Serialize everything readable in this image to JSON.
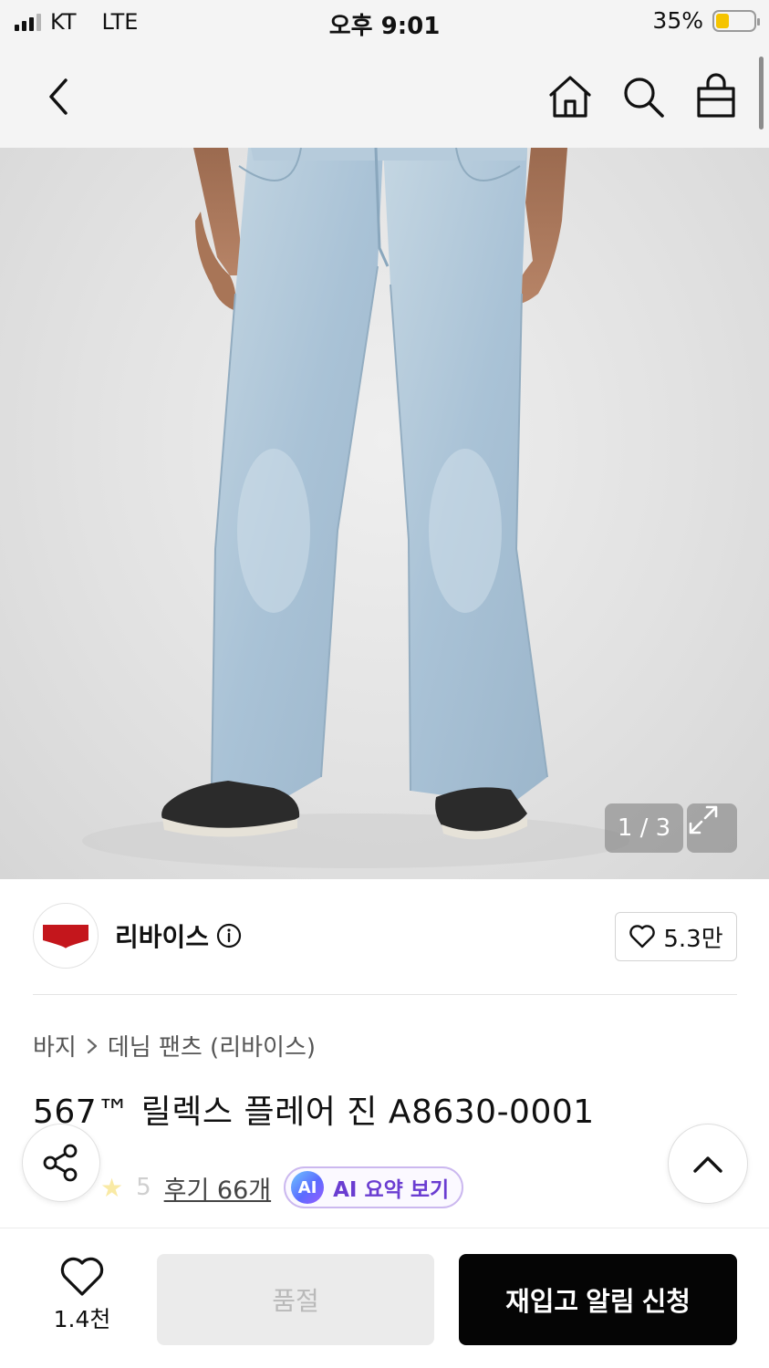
{
  "status_bar": {
    "carrier": "KT",
    "network": "LTE",
    "time": "오후 9:01",
    "battery": "35%",
    "battery_level": 0.35
  },
  "nav": {
    "icons": [
      "back-icon",
      "home-icon",
      "search-icon",
      "shopping-bag-icon"
    ]
  },
  "gallery": {
    "counter": "1 / 3",
    "expand_icon": "expand-icon"
  },
  "brand": {
    "logo_text": "Levi's",
    "name": "리바이스",
    "likes": "5.3만"
  },
  "product": {
    "breadcrumb": [
      "바지",
      "데님 팬츠 (리바이스)"
    ],
    "title": "567™ 릴렉스 플레어 진 A8630-0001",
    "rating": "5",
    "reviews": "후기 66개",
    "ai_badge": "AI",
    "ai_summary": "AI 요약 보기"
  },
  "bottom_bar": {
    "wish_count": "1.4천",
    "soldout_label": "품절",
    "restock_label": "재입고 알림 신청"
  },
  "colors": {
    "accent_ai": "#6a3dd1",
    "cta_bg": "#050505",
    "disabled_bg": "#ebebeb",
    "levis_red": "#c4161c"
  }
}
